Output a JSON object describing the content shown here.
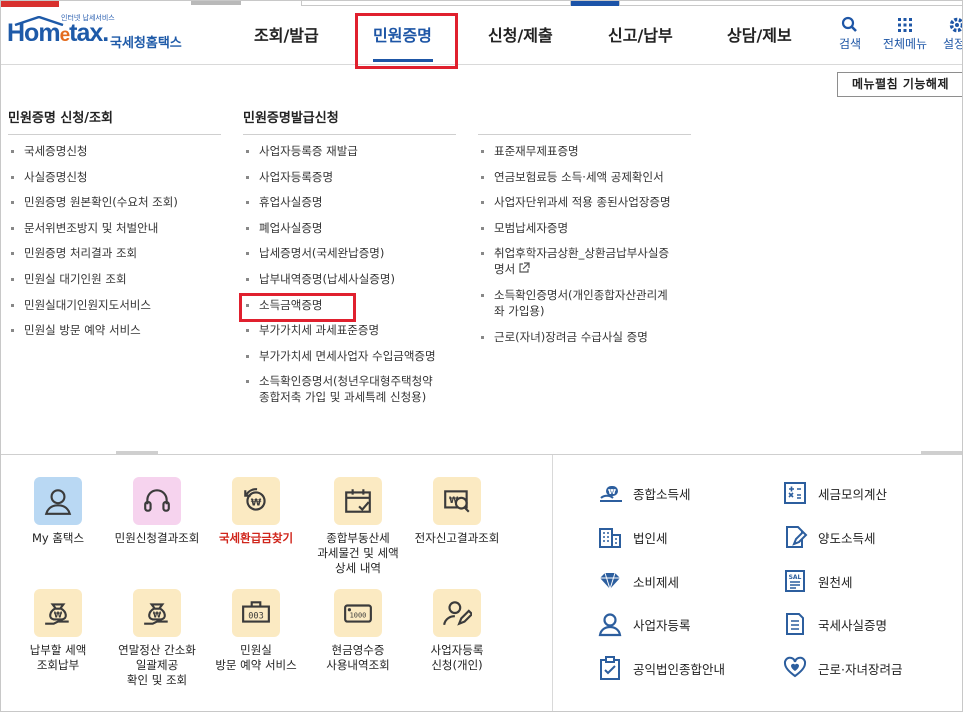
{
  "header": {
    "logo_tagline": "인터넷 납세서비스",
    "logo_main": "Hom",
    "logo_e": "e",
    "logo_tail": "tax.",
    "logo_kr": "국세청홈택스"
  },
  "gnb": [
    {
      "label": "조회/발급"
    },
    {
      "label": "민원증명"
    },
    {
      "label": "신청/제출"
    },
    {
      "label": "신고/납부"
    },
    {
      "label": "상담/제보"
    }
  ],
  "utility": {
    "search_label": "검색",
    "allmenu_label": "전체메뉴",
    "settings_label": "설정"
  },
  "collapse_button": "메뉴펼침 기능해제",
  "columns": [
    {
      "title": "민원증명 신청/조회",
      "items": [
        "국세증명신청",
        "사실증명신청",
        "민원증명 원본확인(수요처 조회)",
        "문서위변조방지 및 처벌안내",
        "민원증명 처리결과 조회",
        "민원실 대기인원 조회",
        "민원실대기인원지도서비스",
        "민원실 방문 예약 서비스"
      ]
    },
    {
      "title": "민원증명발급신청",
      "items": [
        "사업자등록증 재발급",
        "사업자등록증명",
        "휴업사실증명",
        "폐업사실증명",
        "납세증명서(국세완납증명)",
        "납부내역증명(납세사실증명)",
        "소득금액증명",
        "부가가치세 과세표준증명",
        "부가가치세 면세사업자 수입금액증명",
        "소득확인증명서(청년우대형주택청약\n종합저축 가입 및 과세특례 신청용)"
      ]
    },
    {
      "title": "",
      "items": [
        "표준재무제표증명",
        "연금보험료등 소득·세액 공제확인서",
        "사업자단위과세 적용 종된사업장증명",
        "모범납세자증명",
        "취업후학자금상환_상환금납부사실증\n명서",
        "소득확인증명서(개인종합자산관리계\n좌 가입용)",
        "근로(자녀)장려금 수급사실 증명"
      ]
    }
  ],
  "quick_icons": [
    {
      "label": "My 홈택스",
      "icon": "person-icon",
      "color": "#b9d8f3"
    },
    {
      "label": "민원신청결과조회",
      "icon": "headset-icon",
      "color": "#f6d3ee"
    },
    {
      "label": "국세환급금찾기",
      "icon": "refund-won-icon",
      "color": "#fbeac2",
      "highlight": true
    },
    {
      "label": "종합부동산세\n과세물건 및 세액\n상세 내역",
      "icon": "calendar-check-icon",
      "color": "#fbeac2"
    },
    {
      "label": "전자신고결과조회",
      "icon": "search-won-icon",
      "color": "#fbeac2"
    },
    {
      "label": "납부할 세액\n조회납부",
      "icon": "money-bag-hand-icon",
      "color": "#fbeac2"
    },
    {
      "label": "연말정산 간소화\n일괄제공\n확인 및 조회",
      "icon": "money-bag-hand-icon",
      "color": "#fbeac2"
    },
    {
      "label": "민원실\n방문 예약 서비스",
      "icon": "queue-number-icon",
      "color": "#fbeac2",
      "number": "003"
    },
    {
      "label": "현금영수증\n사용내역조회",
      "icon": "cash-receipt-icon",
      "color": "#fbeac2",
      "number": "1000"
    },
    {
      "label": "사업자등록\n신청(개인)",
      "icon": "person-edit-icon",
      "color": "#fbeac2"
    }
  ],
  "tax_links": [
    {
      "label": "종합소득세",
      "icon": "won-stack-icon"
    },
    {
      "label": "세금모의계산",
      "icon": "calculator-icon"
    },
    {
      "label": "법인세",
      "icon": "building-icon"
    },
    {
      "label": "양도소득세",
      "icon": "document-edit-icon"
    },
    {
      "label": "소비제세",
      "icon": "diamond-icon"
    },
    {
      "label": "원천세",
      "icon": "salary-doc-icon",
      "badge": "SAL"
    },
    {
      "label": "사업자등록",
      "icon": "person-icon"
    },
    {
      "label": "국세사실증명",
      "icon": "document-icon"
    },
    {
      "label": "공익법인종합안내",
      "icon": "clipboard-check-icon"
    },
    {
      "label": "근로·자녀장려금",
      "icon": "heart-hands-icon"
    }
  ]
}
